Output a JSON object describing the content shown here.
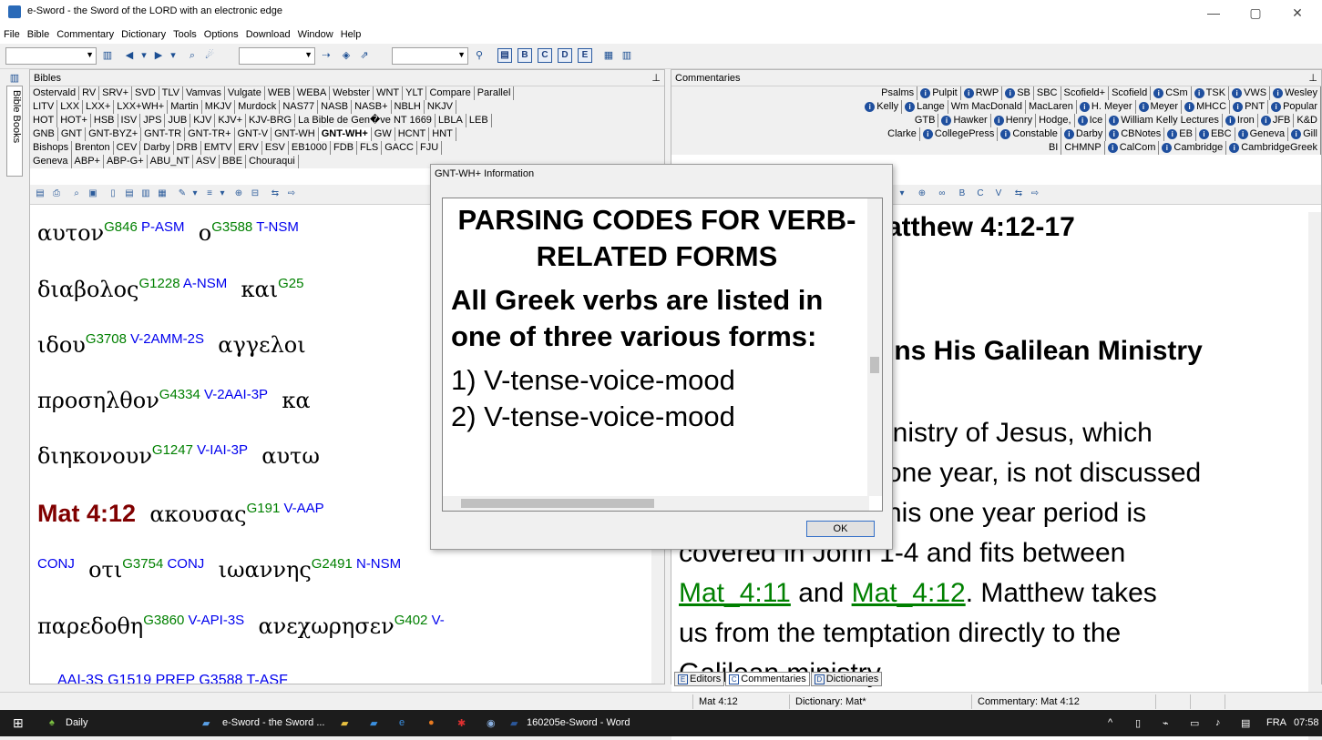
{
  "window": {
    "title": "e-Sword - the Sword of the LORD with an electronic edge",
    "min": "—",
    "max": "▢",
    "close": "✕"
  },
  "menu": [
    "File",
    "Bible",
    "Commentary",
    "Dictionary",
    "Tools",
    "Options",
    "Download",
    "Window",
    "Help"
  ],
  "bibles": {
    "title": "Bibles",
    "side_tab": "Bible Books",
    "tab_rows": [
      [
        "Ostervald",
        "RV",
        "SRV+",
        "SVD",
        "TLV",
        "Vamvas",
        "Vulgate",
        "WEB",
        "WEBA",
        "Webster",
        "WNT",
        "YLT",
        "Compare",
        "Parallel"
      ],
      [
        "LITV",
        "LXX",
        "LXX+",
        "LXX+WH+",
        "Martin",
        "MKJV",
        "Murdock",
        "NAS77",
        "NASB",
        "NASB+",
        "NBLH",
        "NKJV"
      ],
      [
        "HOT",
        "HOT+",
        "HSB",
        "ISV",
        "JPS",
        "JUB",
        "KJV",
        "KJV+",
        "KJV-BRG",
        "La Bible de Gen�ve NT 1669",
        "LBLA",
        "LEB"
      ],
      [
        "GNB",
        "GNT",
        "GNT-BYZ+",
        "GNT-TR",
        "GNT-TR+",
        "GNT-V",
        "GNT-WH",
        "GNT-WH+",
        "GW",
        "HCNT",
        "HNT"
      ],
      [
        "Bishops",
        "Brenton",
        "CEV",
        "Darby",
        "DRB",
        "EMTV",
        "ERV",
        "ESV",
        "EB1000",
        "FDB",
        "FLS",
        "GACC",
        "FJU"
      ],
      [
        "Geneva",
        "ABP+",
        "ABP-G+",
        "ABU_NT",
        "ASV",
        "BBE",
        "Chouraqui"
      ]
    ],
    "active_tab": "GNT-WH+",
    "lines": [
      {
        "greek": "αυτον",
        "num": "G846",
        "parse": "P-ASM",
        "greek2": "ο",
        "num2": "G3588",
        "parse2": "T-NSM"
      },
      {
        "greek": "διαβολος",
        "num": "G1228",
        "parse": "A-NSM",
        "greek2": "και",
        "num2": "G25",
        "parse2": ""
      },
      {
        "greek": "ιδου",
        "num": "G3708",
        "parse": "V-2AMM-2S",
        "greek2": "αγγελοι",
        "num2": "",
        "parse2": ""
      },
      {
        "greek": "προσηλθον",
        "num": "G4334",
        "parse": "V-2AAI-3P",
        "greek2": "κα",
        "num2": "",
        "parse2": ""
      },
      {
        "greek": "διηκονουν",
        "num": "G1247",
        "parse": "V-IAI-3P",
        "greek2": "αυτω",
        "num2": "",
        "parse2": ""
      }
    ],
    "verse_ref": "Mat 4:12",
    "verse_line": {
      "greek": "ακουσας",
      "num": "G191",
      "parse": "V-AAP"
    },
    "line7": {
      "parse0": "CONJ",
      "greek": "οτι",
      "num": "G3754",
      "parse": "CONJ",
      "greek2": "ιωαννης",
      "num2": "G2491",
      "parse2": "N-NSM"
    },
    "line8": {
      "greek": "παρεδοθη",
      "num": "G3860",
      "parse": "V-API-3S",
      "greek2": "ανεχωρησεν",
      "num2": "G402",
      "parse2": "V-"
    },
    "line9": "AAI-3S       G1519 PREP        G3588 T-ASF"
  },
  "commentaries": {
    "title": "Commentaries",
    "tab_rows": [
      [
        "Psalms",
        "i:Pulpit",
        "i:RWP",
        "i:SB",
        "SBC",
        "Scofield+",
        "Scofield",
        "i:CSm",
        "i:TSK",
        "i:VWS",
        "i:Wesley"
      ],
      [
        "i:Kelly",
        "i:Lange",
        "Wm MacDonald",
        "MacLaren",
        "i:H. Meyer",
        "i:Meyer",
        "i:MHCC",
        "i:PNT",
        "i:Popular"
      ],
      [
        "GTB",
        "i:Hawker",
        "i:Henry",
        "Hodge,",
        "i:Ice",
        "i:William Kelly Lectures",
        "i:Iron",
        "i:JFB",
        "K&D"
      ],
      [
        "Clarke",
        "i:CollegePress",
        "i:Constable",
        "i:Darby",
        "i:CBNotes",
        "i:EB",
        "i:EBC",
        "i:Geneva",
        "i:Gill"
      ],
      [
        "BI",
        "CHMNP",
        "i:CalCom",
        "i:Cambridge",
        "i:CambridgeGreek"
      ]
    ],
    "heading1": "atthew 4:12-17",
    "heading2": "ins His Galilean Ministry",
    "para": [
      "inistry of Jesus, which",
      "one year, is not discussed",
      "his one year period is",
      "covered in John 1-4 and fits between"
    ],
    "link1": "Mat_4:11",
    "and": "and",
    "link2": "Mat_4:12",
    "after_link": ". Matthew takes",
    "para2": "us from the temptation directly to the",
    "para3": "Galilean ministry"
  },
  "bottom_tabs": [
    "Editors",
    "Commentaries",
    "Dictionaries"
  ],
  "status": {
    "verse": "Mat 4:12",
    "dictionary": "Dictionary: Mat*",
    "commentary": "Commentary: Mat 4:12"
  },
  "dialog": {
    "title": "GNT-WH+ Information",
    "heading": "PARSING CODES FOR VERB-RELATED FORMS",
    "bold": "All Greek verbs are listed in one of three various forms:",
    "item1": "1) V-tense-voice-mood",
    "item2": "2) V-tense-voice-mood",
    "ok": "OK"
  },
  "taskbar": {
    "weather": "Daily",
    "app1": "e-Sword - the Sword ...",
    "app2": "160205e-Sword - Word",
    "lang": "FRA",
    "time": "07:58"
  }
}
